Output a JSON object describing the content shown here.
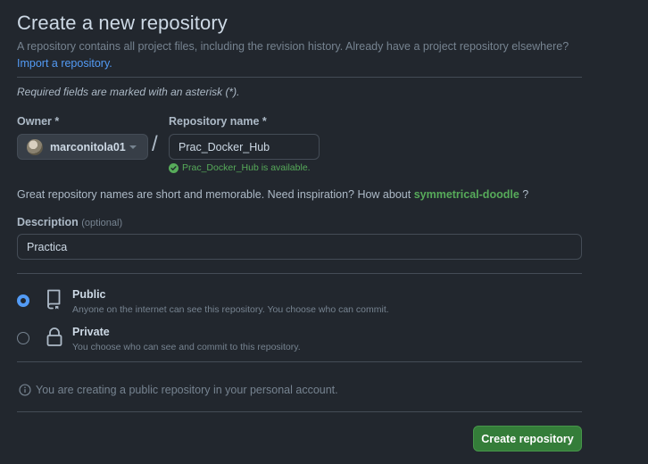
{
  "header": {
    "title": "Create a new repository",
    "subtitle": "A repository contains all project files, including the revision history. Already have a project repository elsewhere?",
    "import_link": "Import a repository."
  },
  "required_note": "Required fields are marked with an asterisk (*).",
  "owner": {
    "label": "Owner *",
    "value": "marconitola01"
  },
  "repo_name": {
    "label": "Repository name *",
    "value": "Prac_Docker_Hub",
    "availability": "Prac_Docker_Hub is available."
  },
  "inspiration": {
    "text": "Great repository names are short and memorable. Need inspiration? How about",
    "suggestion": "symmetrical-doodle",
    "suffix": "?"
  },
  "description": {
    "label": "Description",
    "optional": "(optional)",
    "value": "Practica"
  },
  "visibility": {
    "selected": "public",
    "public": {
      "title": "Public",
      "desc": "Anyone on the internet can see this repository. You choose who can commit."
    },
    "private": {
      "title": "Private",
      "desc": "You choose who can see and commit to this repository."
    }
  },
  "info": "You are creating a public repository in your personal account.",
  "submit_label": "Create repository",
  "colors": {
    "background": "#22272e",
    "accent": "#539bf5",
    "success": "#57ab5a",
    "primary_button": "#347d39"
  }
}
